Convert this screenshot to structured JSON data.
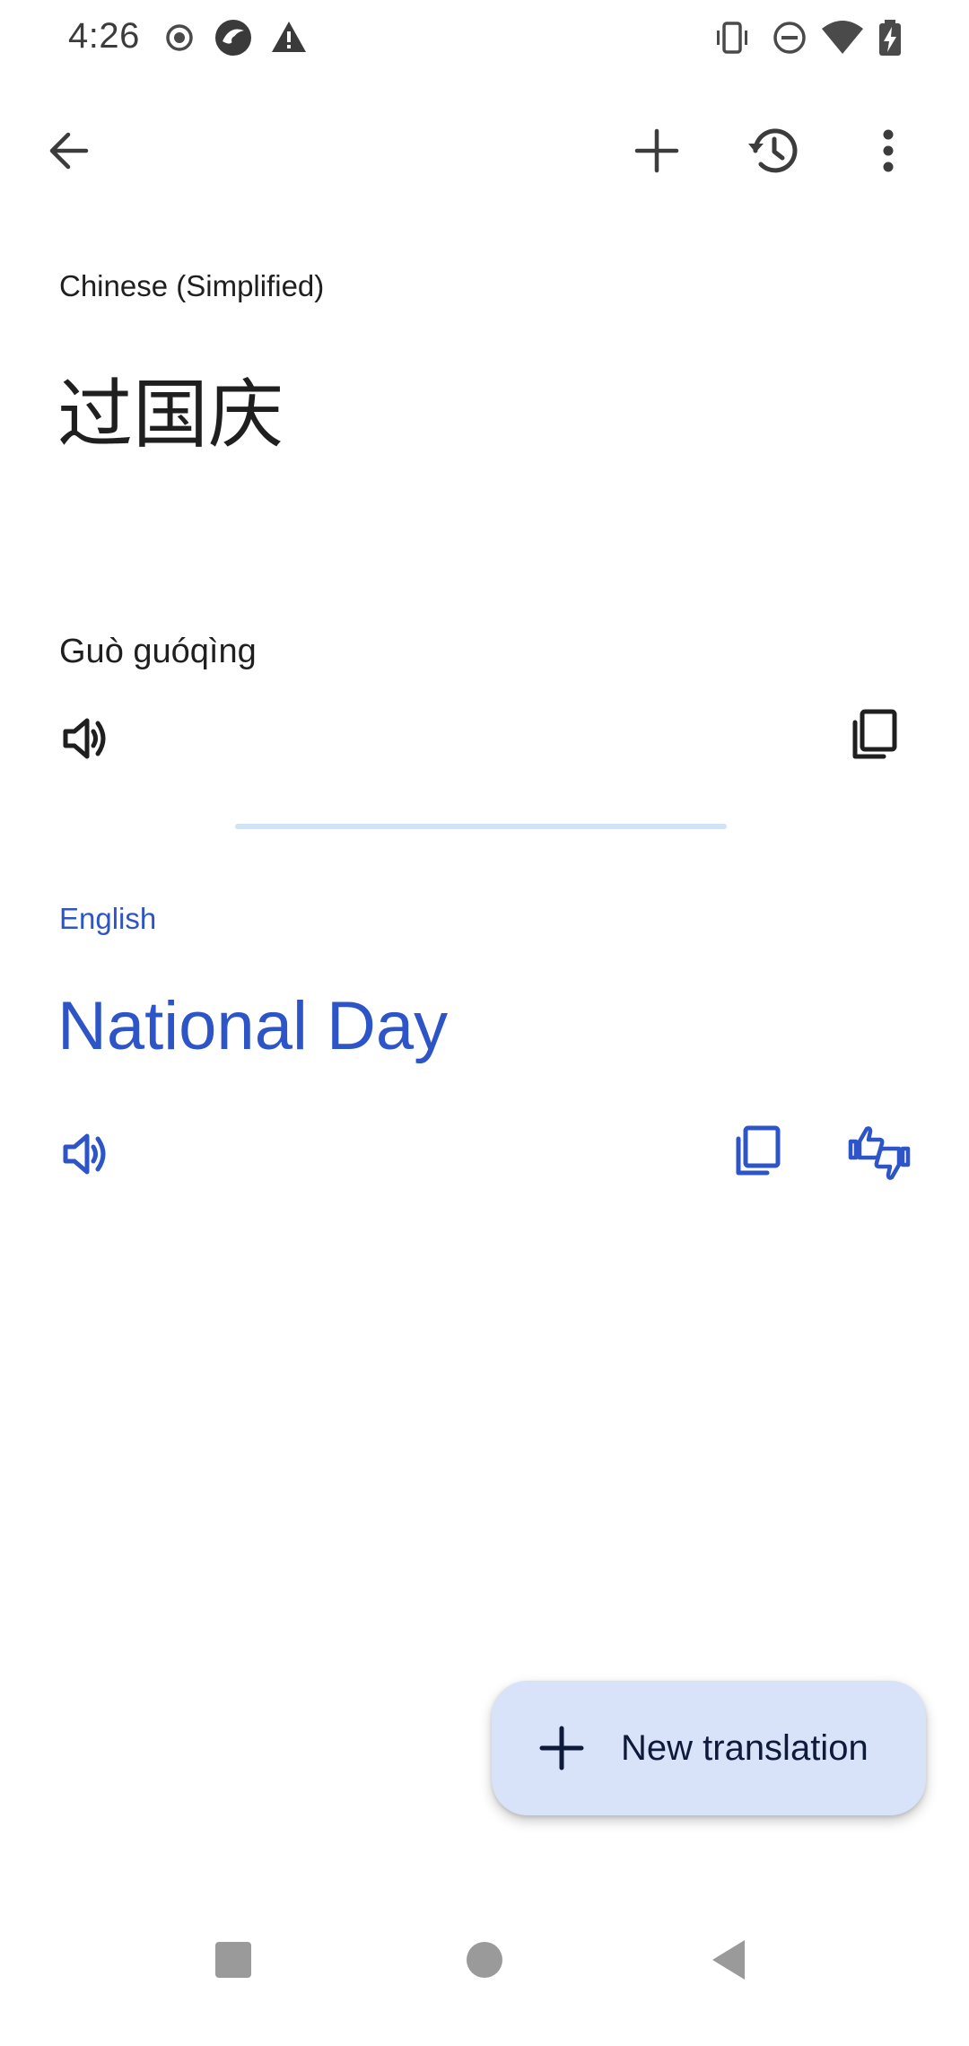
{
  "status_bar": {
    "time": "4:26",
    "left_icons": [
      "record-icon",
      "app-icon",
      "warning-icon"
    ],
    "right_icons": [
      "vibrate-icon",
      "do-not-disturb-icon",
      "wifi-icon",
      "battery-charging-icon"
    ]
  },
  "app_bar": {
    "back_icon": "back-arrow-icon",
    "actions": [
      "add-icon",
      "history-icon",
      "more-vert-icon"
    ]
  },
  "source": {
    "language": "Chinese (Simplified)",
    "text": "过国庆",
    "romanization": "Guò guóqìng"
  },
  "target": {
    "language": "English",
    "text": "National Day"
  },
  "fab": {
    "label": "New translation"
  },
  "colors": {
    "accent": "#2e55c8",
    "divider": "#cfe5f7",
    "fab_background": "#d8e2f8",
    "text_primary": "#1f1f1f"
  },
  "nav_bar": {
    "buttons": [
      "recents-icon",
      "home-icon",
      "back-icon"
    ]
  }
}
